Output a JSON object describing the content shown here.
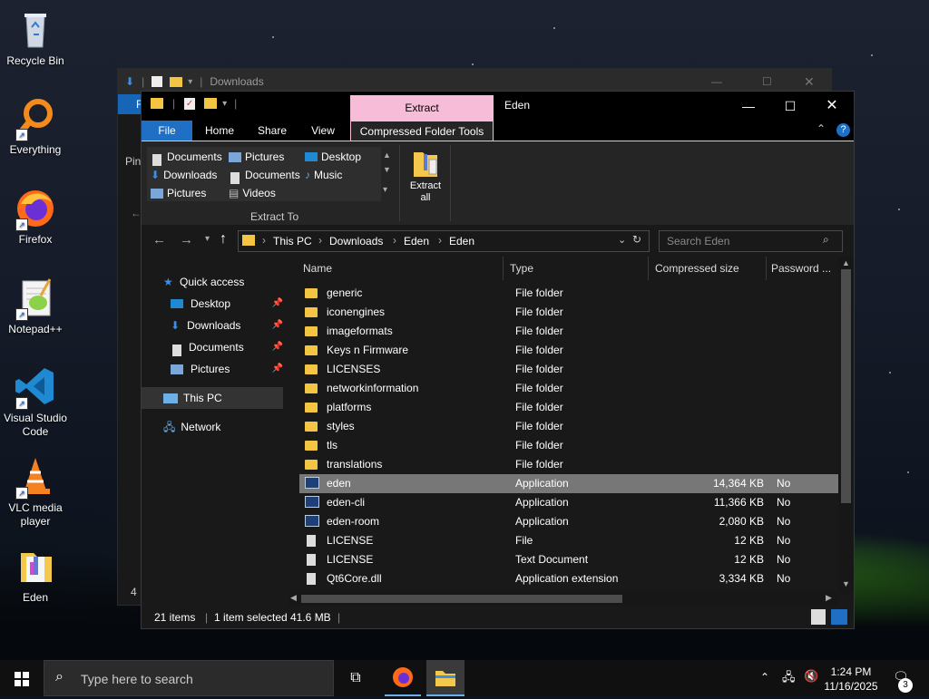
{
  "desktop": {
    "icons": [
      {
        "label": "Recycle Bin"
      },
      {
        "label": "Everything"
      },
      {
        "label": "Firefox"
      },
      {
        "label": "Notepad++"
      },
      {
        "label": "Visual Studio Code"
      },
      {
        "label": "VLC media player"
      },
      {
        "label": "Eden"
      }
    ]
  },
  "back_window": {
    "title": "Downloads",
    "tab_fragment": "F",
    "ribbon_fragment": "Pin",
    "status_fragment": "4"
  },
  "window": {
    "title": "Eden",
    "context_tab": "Extract",
    "tabs": [
      "File",
      "Home",
      "Share",
      "View",
      "Compressed Folder Tools"
    ],
    "ribbon": {
      "extract_to_links": [
        "Documents",
        "Pictures",
        "Desktop",
        "Downloads",
        "Documents",
        "Music",
        "Pictures",
        "Videos"
      ],
      "extract_to_label": "Extract To",
      "extract_all_label": "Extract\nall"
    },
    "address": {
      "breadcrumb": [
        "This PC",
        "Downloads",
        "Eden",
        "Eden"
      ],
      "search_placeholder": "Search Eden"
    },
    "nav": {
      "quick_access": "Quick access",
      "pinned": [
        "Desktop",
        "Downloads",
        "Documents",
        "Pictures"
      ],
      "this_pc": "This PC",
      "network": "Network"
    },
    "columns": [
      "Name",
      "Type",
      "Compressed size",
      "Password ..."
    ],
    "rows": [
      {
        "name": "generic",
        "type": "File folder",
        "size": "",
        "pw": "",
        "icon": "folder"
      },
      {
        "name": "iconengines",
        "type": "File folder",
        "size": "",
        "pw": "",
        "icon": "folder"
      },
      {
        "name": "imageformats",
        "type": "File folder",
        "size": "",
        "pw": "",
        "icon": "folder"
      },
      {
        "name": "Keys n Firmware",
        "type": "File folder",
        "size": "",
        "pw": "",
        "icon": "folder"
      },
      {
        "name": "LICENSES",
        "type": "File folder",
        "size": "",
        "pw": "",
        "icon": "folder"
      },
      {
        "name": "networkinformation",
        "type": "File folder",
        "size": "",
        "pw": "",
        "icon": "folder"
      },
      {
        "name": "platforms",
        "type": "File folder",
        "size": "",
        "pw": "",
        "icon": "folder"
      },
      {
        "name": "styles",
        "type": "File folder",
        "size": "",
        "pw": "",
        "icon": "folder"
      },
      {
        "name": "tls",
        "type": "File folder",
        "size": "",
        "pw": "",
        "icon": "folder"
      },
      {
        "name": "translations",
        "type": "File folder",
        "size": "",
        "pw": "",
        "icon": "folder"
      },
      {
        "name": "eden",
        "type": "Application",
        "size": "14,364 KB",
        "pw": "No",
        "icon": "app",
        "selected": true
      },
      {
        "name": "eden-cli",
        "type": "Application",
        "size": "11,366 KB",
        "pw": "No",
        "icon": "app"
      },
      {
        "name": "eden-room",
        "type": "Application",
        "size": "2,080 KB",
        "pw": "No",
        "icon": "app"
      },
      {
        "name": "LICENSE",
        "type": "File",
        "size": "12 KB",
        "pw": "No",
        "icon": "file"
      },
      {
        "name": "LICENSE",
        "type": "Text Document",
        "size": "12 KB",
        "pw": "No",
        "icon": "file"
      },
      {
        "name": "Qt6Core.dll",
        "type": "Application extension",
        "size": "3,334 KB",
        "pw": "No",
        "icon": "file"
      }
    ],
    "status": {
      "items": "21 items",
      "selected": "1 item selected",
      "size": "41.6 MB"
    }
  },
  "taskbar": {
    "search_placeholder": "Type here to search",
    "time": "1:24 PM",
    "date": "11/16/2025",
    "notification_count": "3"
  }
}
